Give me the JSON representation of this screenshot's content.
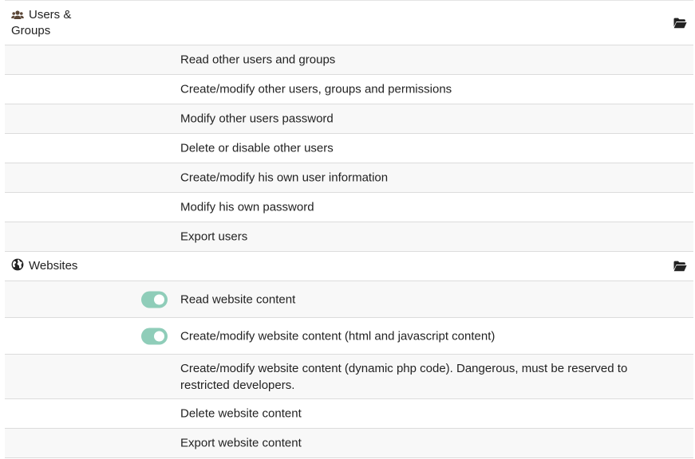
{
  "sections": [
    {
      "title_line1": "Users &",
      "title_line2": "Groups",
      "icon": "users-icon",
      "folder_icon": "folder-open-icon",
      "permissions": [
        {
          "label": "Read other users and groups"
        },
        {
          "label": "Create/modify other users, groups and permissions"
        },
        {
          "label": "Modify other users password"
        },
        {
          "label": "Delete or disable other users"
        },
        {
          "label": "Create/modify his own user information"
        },
        {
          "label": "Modify his own password"
        },
        {
          "label": "Export users"
        }
      ]
    },
    {
      "title": "Websites",
      "icon": "globe-icon",
      "folder_icon": "folder-open-icon",
      "permissions": [
        {
          "label": "Read website content",
          "enabled": true
        },
        {
          "label": "Create/modify website content (html and javascript content)",
          "enabled": true
        },
        {
          "label": "Create/modify website content (dynamic php code). Dangerous, must be reserved to restricted developers."
        },
        {
          "label": "Delete website content"
        },
        {
          "label": "Export website content"
        }
      ]
    }
  ],
  "colors": {
    "toggle_on": "#8fcdb9",
    "row_alt": "#f8f8f8",
    "border": "#dcdcdc"
  }
}
